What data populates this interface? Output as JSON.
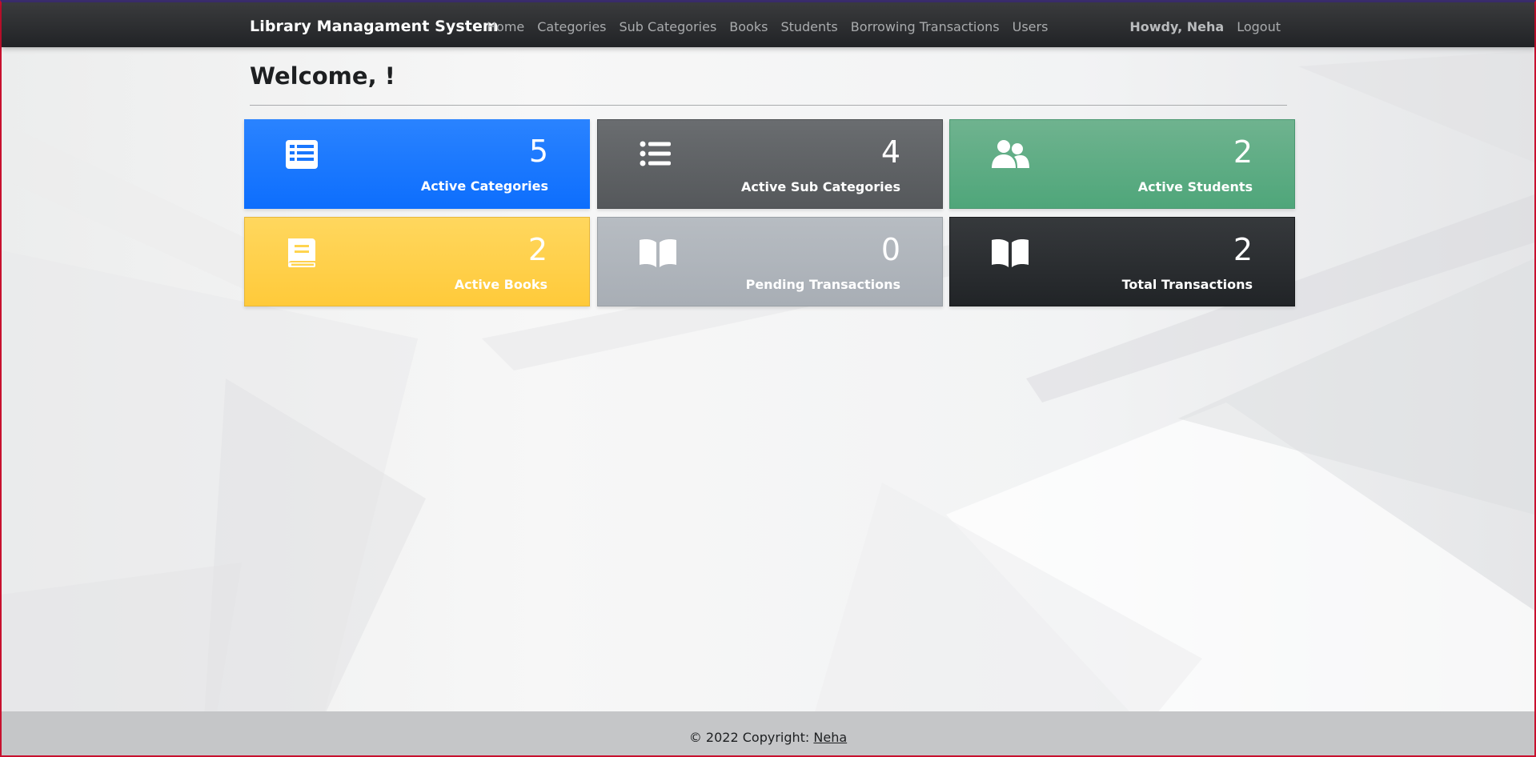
{
  "navbar": {
    "brand": "Library Managament System",
    "links": [
      "Home",
      "Categories",
      "Sub Categories",
      "Books",
      "Students",
      "Borrowing Transactions",
      "Users"
    ],
    "greeting": "Howdy, Neha",
    "logout": "Logout"
  },
  "main": {
    "welcome": "Welcome,  !"
  },
  "cards": [
    {
      "value": "5",
      "label": "Active Categories",
      "icon": "table-list-icon",
      "color": "#0d6efd"
    },
    {
      "value": "4",
      "label": "Active Sub Categories",
      "icon": "list-icon",
      "color": "#5c5f62"
    },
    {
      "value": "2",
      "label": "Active Students",
      "icon": "users-icon",
      "color": "#5aaa82"
    },
    {
      "value": "2",
      "label": "Active Books",
      "icon": "book-icon",
      "color": "#ffcf4a"
    },
    {
      "value": "0",
      "label": "Pending Transactions",
      "icon": "open-book-icon",
      "color": "#adb3b9"
    },
    {
      "value": "2",
      "label": "Total Transactions",
      "icon": "open-book-icon",
      "color": "#2a2d30"
    }
  ],
  "footer": {
    "prefix": "© 2022 Copyright: ",
    "link": "Neha"
  }
}
